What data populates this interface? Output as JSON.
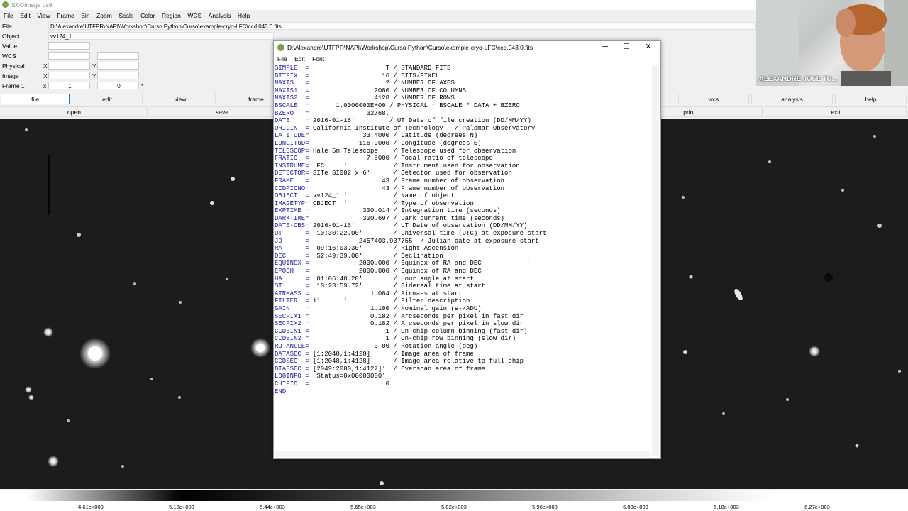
{
  "ds9": {
    "title": "SAOImage ds9",
    "menu": [
      "File",
      "Edit",
      "View",
      "Frame",
      "Bin",
      "Zoom",
      "Scale",
      "Color",
      "Region",
      "WCS",
      "Analysis",
      "Help"
    ],
    "file_label": "File",
    "file_value": "D:\\Alexandre\\UTFPR\\NAPI\\Workshop\\Curso Python\\Curso\\example-cryo-LFC\\ccd.043.0.fits",
    "object_label": "Object",
    "object_value": "vv124_1",
    "value_label": "Value",
    "wcs_label": "WCS",
    "physical_label": "Physical",
    "image_label": "Image",
    "frame_label": "Frame 1",
    "x_label": "X",
    "y_label": "Y",
    "frame_x": "x",
    "frame_val1": "1",
    "frame_val2": "0",
    "frame_star": "*",
    "buttons_row1": [
      "file",
      "edit",
      "view",
      "frame",
      "wcs",
      "analysis",
      "help"
    ],
    "buttons_row2": [
      "open",
      "save",
      "print",
      "exit"
    ],
    "colorbar_ticks": [
      "4.61e+003",
      "5.13e+003",
      "5.44e+003",
      "5.65e+003",
      "5.82e+003",
      "5.96e+003",
      "6.08e+003",
      "6.18e+003",
      "6.27e+003"
    ]
  },
  "dialog": {
    "title": "D:\\Alexandre\\UTFPR\\NAPI\\Workshop\\Curso Python\\Curso\\example-cryo-LFC\\ccd.043.0.fits",
    "menu": [
      "File",
      "Edit",
      "Font"
    ],
    "minimize": "─",
    "maximize": "☐",
    "close": "✕",
    "header_lines": [
      [
        "SIMPLE  =",
        "                    T / STANDARD FITS"
      ],
      [
        "BITPIX  =",
        "                   16 / BITS/PIXEL"
      ],
      [
        "NAXIS   =",
        "                    2 / NUMBER OF AXES"
      ],
      [
        "NAXIS1  =",
        "                 2080 / NUMBER OF COLUMNS"
      ],
      [
        "NAXIS2  =",
        "                 4128 / NUMBER OF ROWS"
      ],
      [
        "BSCALE  =",
        "       1.0000000E+00 / PHYSICAL = BSCALE * DATA + BZERO"
      ],
      [
        "BZERO   =",
        "               32768."
      ],
      [
        "DATE    =",
        "'2016-01-16'         / UT Date of file creation (DD/MM/YY)"
      ],
      [
        "ORIGIN  =",
        "'California Institute of Technology'  / Palomar Observatory"
      ],
      [
        "LATITUDE=",
        "              33.4000 / Latitude (degrees N)"
      ],
      [
        "LONGITUD=",
        "            -116.9000 / Longitude (degrees E)"
      ],
      [
        "TELESCOP=",
        "'Hale 5m Telescope'   / Telescope used for observation"
      ],
      [
        "FRATIO  =",
        "               7.5000 / Focal ratio of telescope"
      ],
      [
        "INSTRUME=",
        "'LFC     '            / Instrument used for observation"
      ],
      [
        "DETECTOR=",
        "'SITe SI002 x 6'      / Detector used for observation"
      ],
      [
        "FRAME   =",
        "                   43 / Frame number of observation"
      ],
      [
        "CCDPICNO=",
        "                   43 / Frame number of observation"
      ],
      [
        "OBJECT  =",
        "'vv124_1 '            / Name of object"
      ],
      [
        "IMAGETYP=",
        "'OBJECT  '            / Type of observation"
      ],
      [
        "EXPTIME =",
        "              300.014 / Integration time (seconds)"
      ],
      [
        "DARKTIME=",
        "              300.697 / Dark current time (seconds)"
      ],
      [
        "DATE-OBS=",
        "'2016-01-16'          / UT Date of observation (DD/MM/YY)"
      ],
      [
        "UT      =",
        "' 10:30:22.00'        / Universal time (UTC) at exposure start"
      ],
      [
        "JD      =",
        "             2457403.937755  / Julian date at exposure start"
      ],
      [
        "RA      =",
        "' 09:16:03.30'        / Right Ascension"
      ],
      [
        "DEC     =",
        "' 52:49:39.00'        / Declination"
      ],
      [
        "EQUINOX =",
        "             2000.000 / Equinox of RA and DEC"
      ],
      [
        "EPOCH   =",
        "             2000.000 / Equinox of RA and DEC"
      ],
      [
        "HA      =",
        "' 01:06:48.20'        / Hour angle at start"
      ],
      [
        "ST      =",
        "' 10:23:59.72'        / Sidereal time at start"
      ],
      [
        "AIRMASS =",
        "                1.084 / Airmass at start"
      ],
      [
        "FILTER  =",
        "'i'      '            / Filter description"
      ],
      [
        "GAIN    =",
        "                1.100 / Nominal gain (e-/ADU)"
      ],
      [
        "SECPIX1 =",
        "                0.182 / Arcseconds per pixel in fast dir"
      ],
      [
        "SECPIX2 =",
        "                0.182 / Arcseconds per pixel in slow dir"
      ],
      [
        "CCDBIN1 =",
        "                    1 / On-chip column binning (fast dir)"
      ],
      [
        "CCDBIN2 =",
        "                    1 / On-chip row binning (slow dir)"
      ],
      [
        "ROTANGLE=",
        "                 0.00 / Rotation angle (deg)"
      ],
      [
        "DATASEC =",
        "'[1:2048,1:4128]'     / Image area of frame"
      ],
      [
        "CCDSEC  =",
        "'[1:2048,1:4128]'     / Image area relative to full chip"
      ],
      [
        "BIASSEC =",
        "'[2049:2080,1:4127]'  / Overscan area of frame"
      ],
      [
        "LOGINFO =",
        "' Status=0x00000000'"
      ],
      [
        "CHIPID  =",
        "                    0"
      ],
      [
        "END",
        ""
      ]
    ]
  },
  "webcam": {
    "name": "ALEXANDRE JOSE TU..."
  }
}
